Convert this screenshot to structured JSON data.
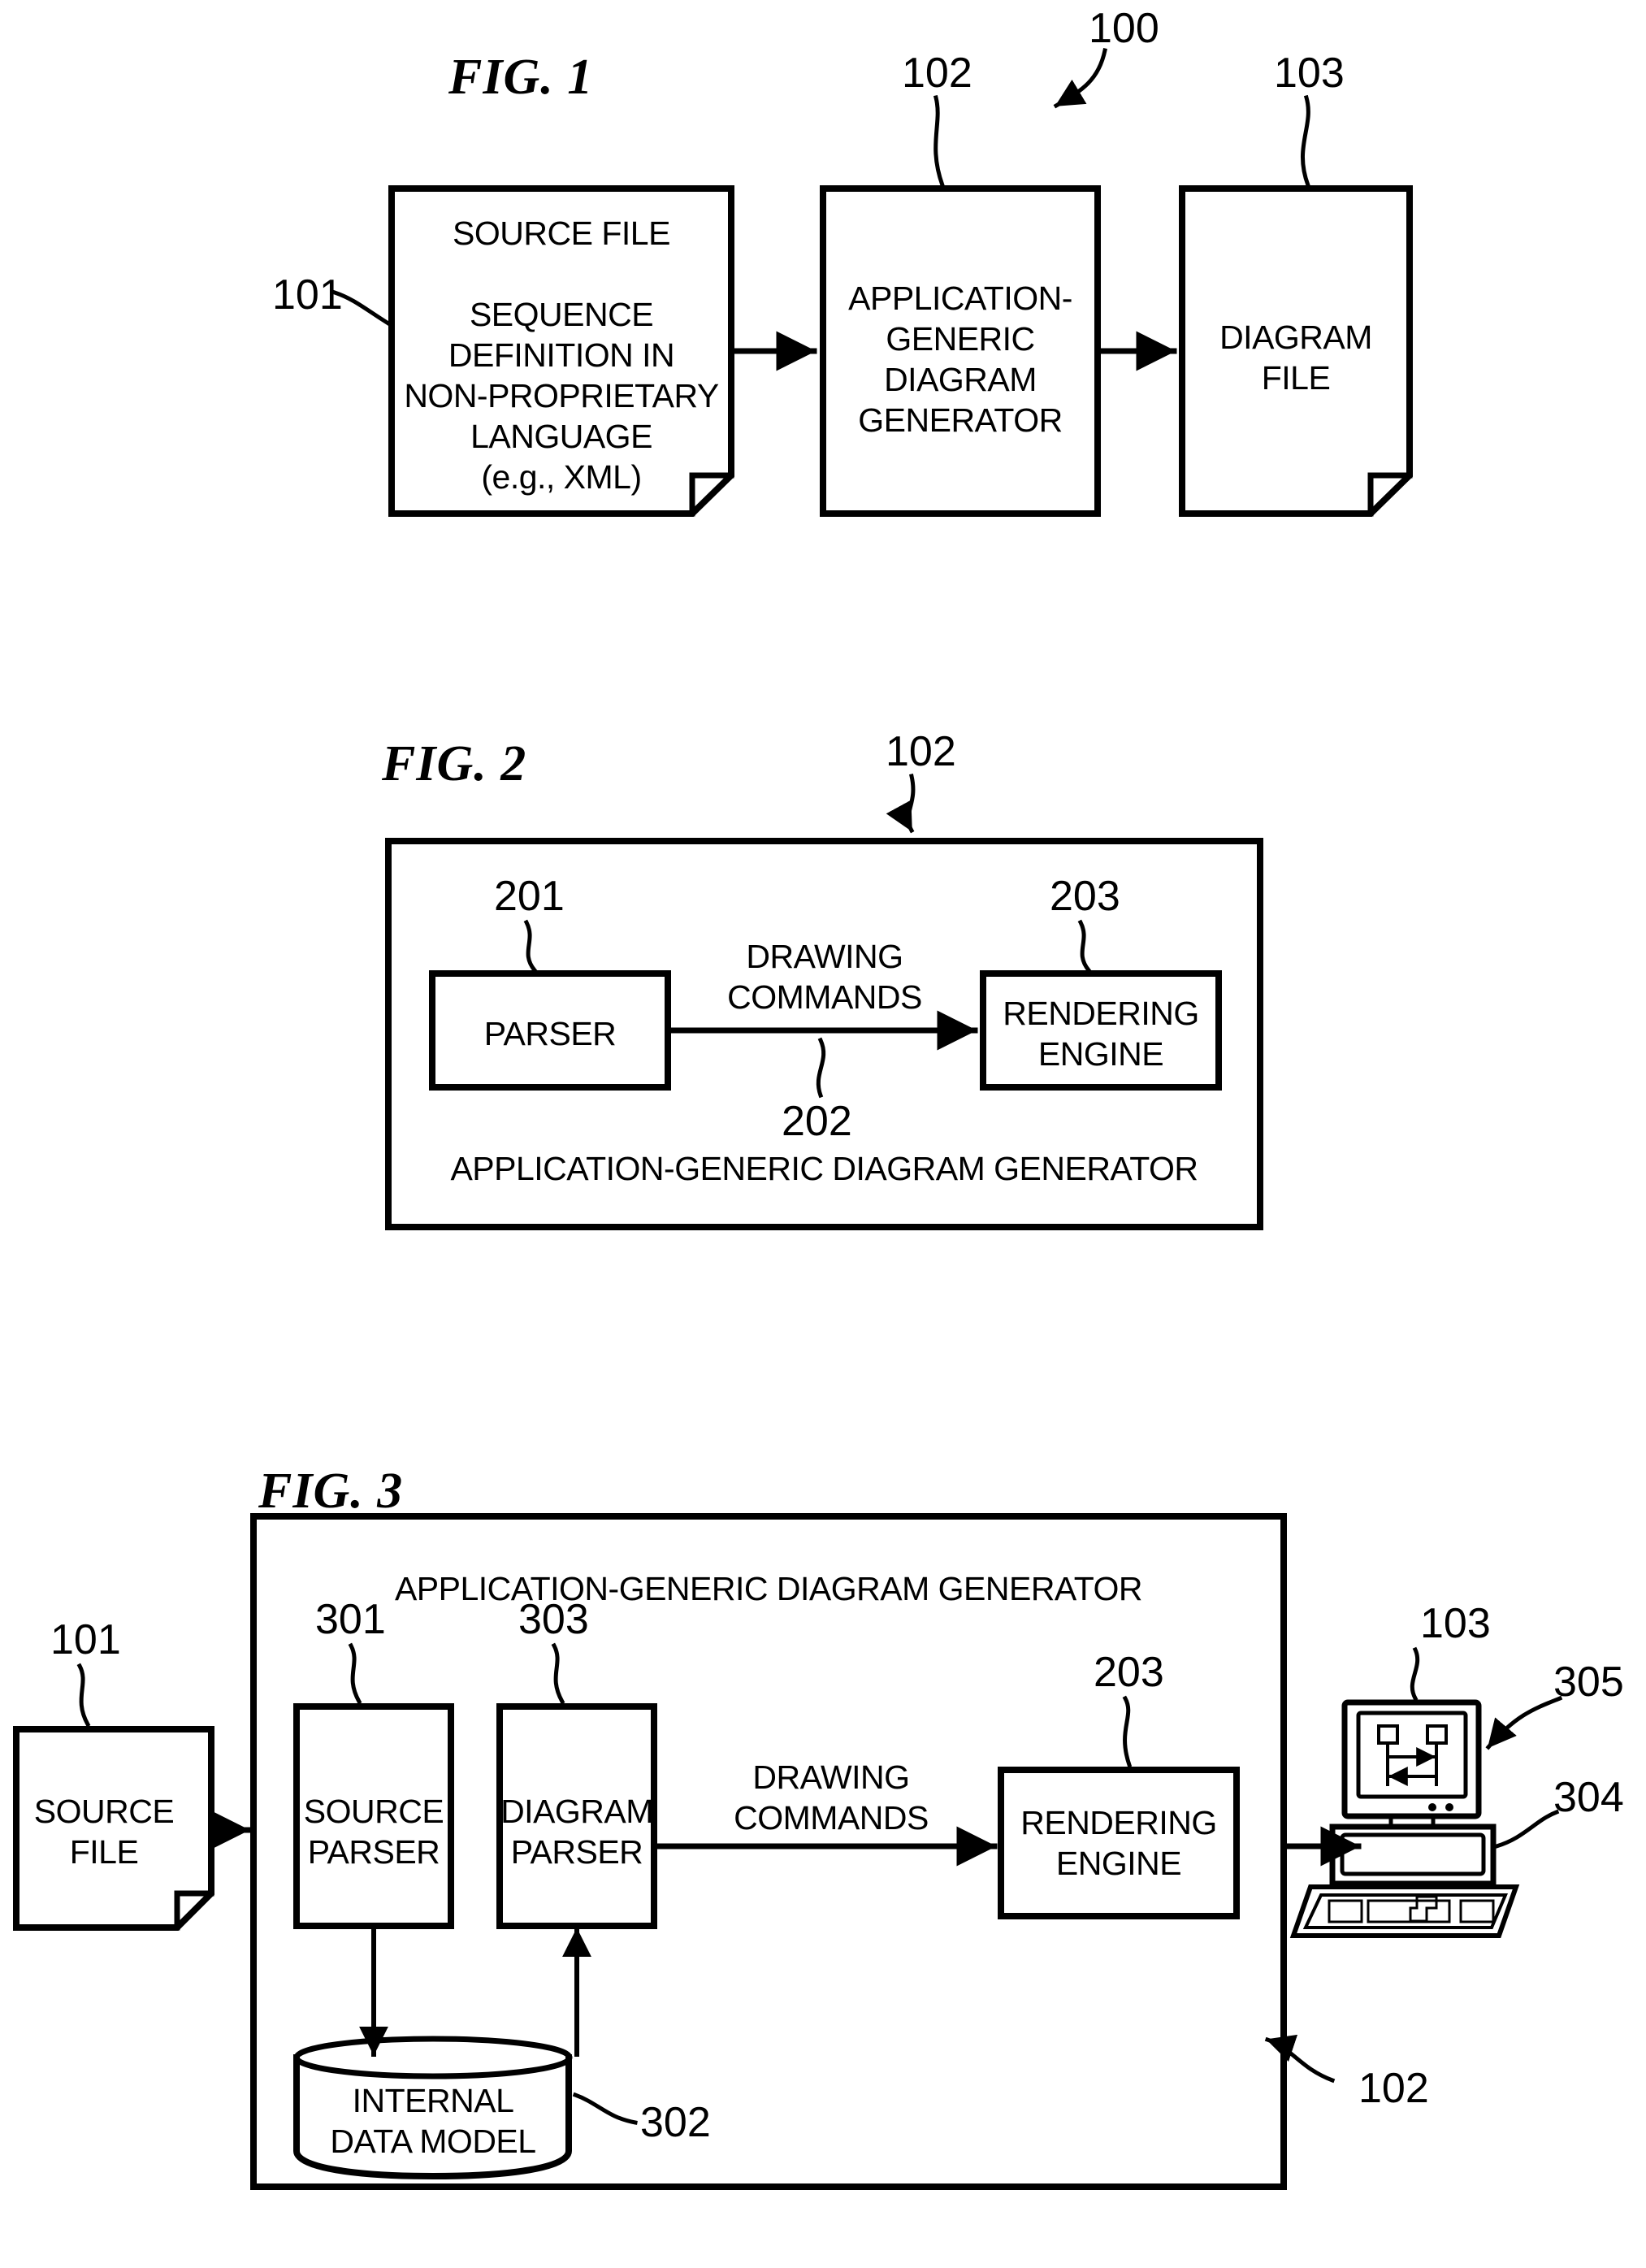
{
  "document": {
    "kind": "patent-drawing-sheet",
    "background_color": "#ffffff",
    "ink_color": "#000000"
  },
  "figures": [
    {
      "id": "fig1",
      "label": "FIG. 1",
      "system_ref": "100",
      "nodes": [
        {
          "id": "source-file",
          "ref": "101",
          "shape": "document",
          "text": "SOURCE FILE\n\nSEQUENCE\nDEFINITION IN\nNON-PROPRIETARY\nLANGUAGE\n(e.g., XML)"
        },
        {
          "id": "diagram-generator",
          "ref": "102",
          "shape": "rectangle",
          "text": "APPLICATION-\nGENERIC\nDIAGRAM\nGENERATOR"
        },
        {
          "id": "diagram-file",
          "ref": "103",
          "shape": "document",
          "text": "DIAGRAM\nFILE"
        }
      ]
    },
    {
      "id": "fig2",
      "label": "FIG. 2",
      "container_ref": "102",
      "container_caption": "APPLICATION-GENERIC DIAGRAM GENERATOR",
      "nodes": [
        {
          "id": "parser",
          "ref": "201",
          "shape": "rectangle",
          "text": "PARSER"
        },
        {
          "id": "rendering-engine",
          "ref": "203",
          "shape": "rectangle",
          "text": "RENDERING\nENGINE"
        }
      ],
      "edges": [
        {
          "id": "drawing-commands",
          "ref": "202",
          "label": "DRAWING\nCOMMANDS",
          "from": "parser",
          "to": "rendering-engine"
        }
      ]
    },
    {
      "id": "fig3",
      "label": "FIG. 3",
      "container_ref": "102",
      "container_caption": "APPLICATION-GENERIC DIAGRAM GENERATOR",
      "nodes": [
        {
          "id": "source-file",
          "ref": "101",
          "shape": "document",
          "text": "SOURCE\nFILE"
        },
        {
          "id": "source-parser",
          "ref": "301",
          "shape": "rectangle",
          "text": "SOURCE\nPARSER"
        },
        {
          "id": "diagram-parser",
          "ref": "303",
          "shape": "rectangle",
          "text": "DIAGRAM\nPARSER"
        },
        {
          "id": "rendering-engine",
          "ref": "203",
          "shape": "rectangle",
          "text": "RENDERING\nENGINE"
        },
        {
          "id": "internal-data-model",
          "ref": "302",
          "shape": "cylinder",
          "text": "INTERNAL\nDATA MODEL"
        },
        {
          "id": "computer",
          "ref": "103",
          "shape": "computer-workstation",
          "text": ""
        },
        {
          "id": "display",
          "ref": "305",
          "shape": "pointer",
          "text": ""
        },
        {
          "id": "computer-base",
          "ref": "304",
          "shape": "pointer",
          "text": ""
        }
      ],
      "edges": [
        {
          "id": "drawing-commands",
          "label": "DRAWING\nCOMMANDS",
          "from": "diagram-parser",
          "to": "rendering-engine"
        }
      ]
    }
  ]
}
